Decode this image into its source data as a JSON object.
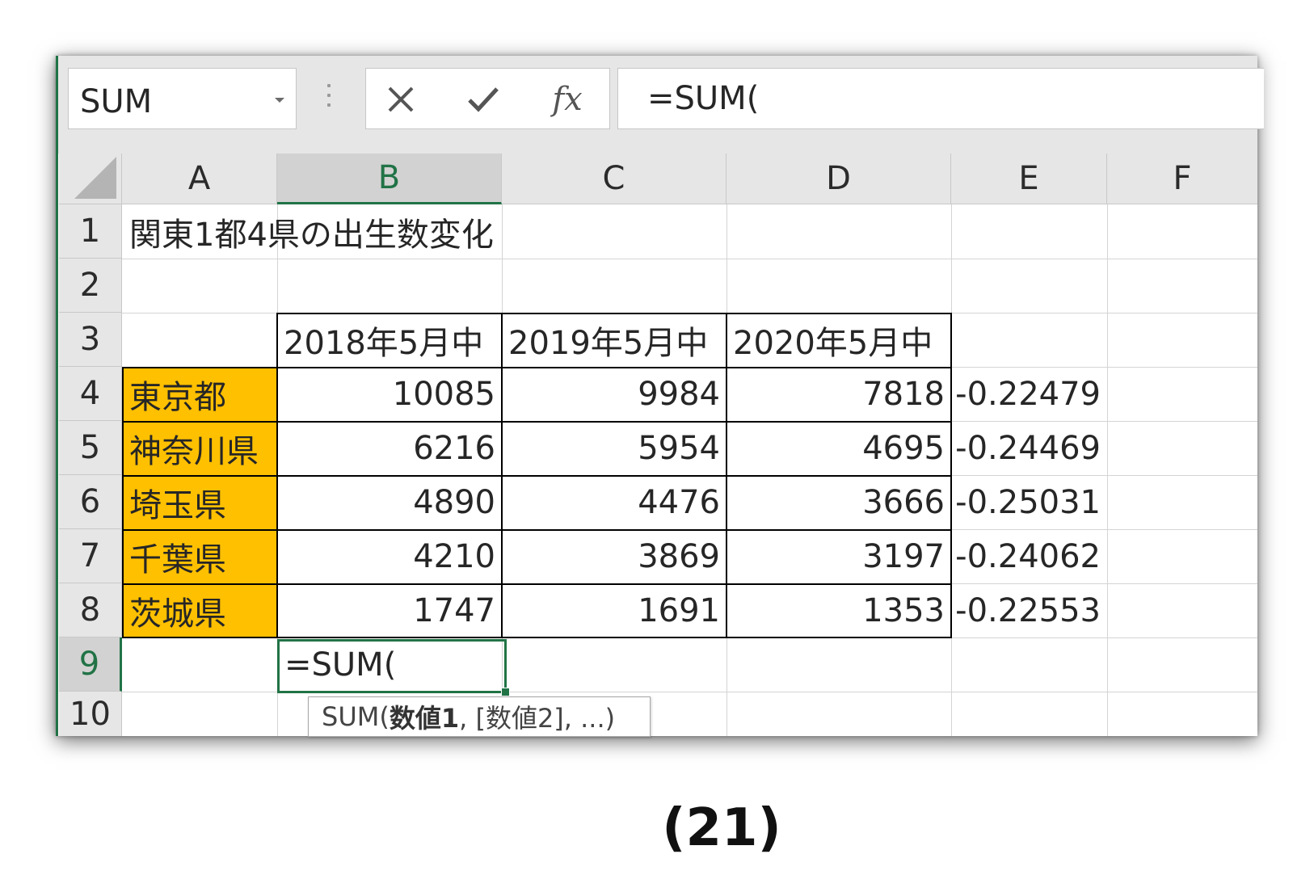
{
  "name_box": {
    "value": "SUM"
  },
  "formula_bar": {
    "cancel_symbol": "✕",
    "enter_symbol": "✓",
    "fx_label": "fx",
    "formula": "=SUM("
  },
  "columns": [
    "A",
    "B",
    "C",
    "D",
    "E",
    "F"
  ],
  "rows": [
    "1",
    "2",
    "3",
    "4",
    "5",
    "6",
    "7",
    "8",
    "9",
    "10"
  ],
  "cells": {
    "A1": "関東1都4県の出生数変化",
    "B3": "2018年5月中",
    "C3": "2019年5月中",
    "D3": "2020年5月中",
    "A4": "東京都",
    "B4": "10085",
    "C4": "9984",
    "D4": "7818",
    "E4": "-0.22479",
    "A5": "神奈川県",
    "B5": "6216",
    "C5": "5954",
    "D5": "4695",
    "E5": "-0.24469",
    "A6": "埼玉県",
    "B6": "4890",
    "C6": "4476",
    "D6": "3666",
    "E6": "-0.25031",
    "A7": "千葉県",
    "B7": "4210",
    "C7": "3869",
    "D7": "3197",
    "E7": "-0.24062",
    "A8": "茨城県",
    "B8": "1747",
    "C8": "1691",
    "D8": "1353",
    "E8": "-0.22553",
    "B9": "=SUM("
  },
  "selection": {
    "active_cell": "B9",
    "active_column": "B",
    "active_row": "9"
  },
  "tooltip": {
    "func": "SUM(",
    "arg_bold": "数値1",
    "rest": ", [数値2], ...)"
  },
  "caption": "(21)",
  "colors": {
    "accent": "#217346",
    "highlight": "#ffc000",
    "header_bg": "#e6e6e6"
  }
}
